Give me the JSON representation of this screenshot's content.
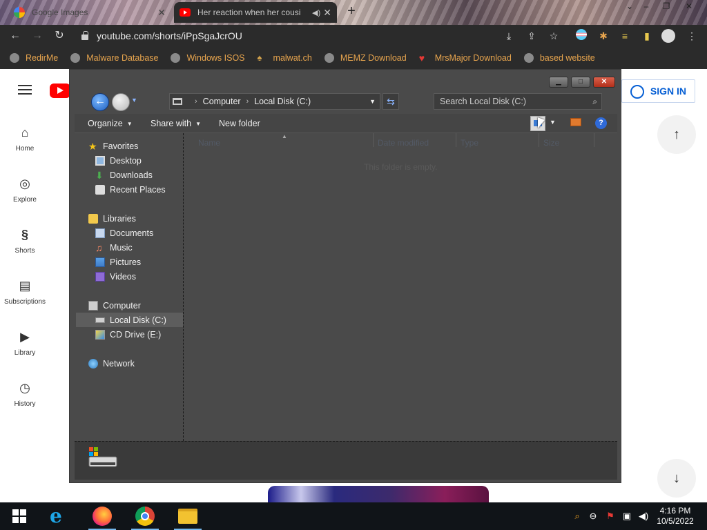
{
  "browser": {
    "tabs": [
      {
        "title": "Google Images",
        "close": "✕",
        "active": false
      },
      {
        "title": "Her reaction when her cousi",
        "close": "✕",
        "active": true
      }
    ],
    "new_tab": "+",
    "window_controls": {
      "minimize": "–",
      "restore": "❐",
      "close": "✕"
    },
    "address": "youtube.com/shorts/iPpSgaJcrOU",
    "bookmarks": [
      "RedirMe",
      "Malware Database",
      "Windows ISOS",
      "malwat.ch",
      "MEMZ Download",
      "MrsMajor Download",
      "based website"
    ]
  },
  "youtube": {
    "sidebar": [
      "Home",
      "Explore",
      "Shorts",
      "Subscriptions",
      "Library",
      "History"
    ],
    "sign_in": "SIGN IN"
  },
  "explorer": {
    "breadcrumb": [
      "Computer",
      "Local Disk (C:)"
    ],
    "search_placeholder": "Search Local Disk (C:)",
    "commands": {
      "organize": "Organize",
      "share_with": "Share with",
      "new_folder": "New folder"
    },
    "help": "?",
    "nav": {
      "favorites": {
        "label": "Favorites",
        "items": [
          "Desktop",
          "Downloads",
          "Recent Places"
        ]
      },
      "libraries": {
        "label": "Libraries",
        "items": [
          "Documents",
          "Music",
          "Pictures",
          "Videos"
        ]
      },
      "computer": {
        "label": "Computer",
        "items": [
          "Local Disk (C:)",
          "CD Drive (E:)"
        ],
        "selected": "Local Disk (C:)"
      },
      "network": {
        "label": "Network"
      }
    },
    "columns": [
      "Name",
      "Date modified",
      "Type",
      "Size"
    ],
    "empty_message": "This folder is empty."
  },
  "taskbar": {
    "time": "4:16 PM",
    "date": "10/5/2022",
    "apps": [
      "start",
      "internet-explorer",
      "firefox",
      "chrome",
      "file-explorer"
    ]
  },
  "colors": {
    "accent": "#065fd4",
    "bookmark_text": "#e8a54e",
    "youtube_red": "#ff0000"
  }
}
